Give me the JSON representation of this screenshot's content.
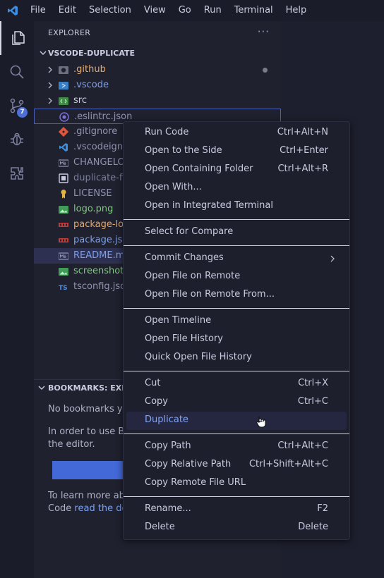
{
  "menubar": {
    "items": [
      "File",
      "Edit",
      "Selection",
      "View",
      "Go",
      "Run",
      "Terminal",
      "Help"
    ]
  },
  "activity_bar": {
    "scm_badge": "7"
  },
  "sidebar": {
    "title": "EXPLORER",
    "more_icon": "···"
  },
  "explorer": {
    "project": "VSCODE-DUPLICATE",
    "items": [
      {
        "name": ".github",
        "icon": "github-folder-icon"
      },
      {
        "name": ".vscode",
        "icon": "vscode-folder-icon"
      },
      {
        "name": "src",
        "icon": "src-folder-icon"
      },
      {
        "name": ".eslintrc.json",
        "icon": "eslint-icon"
      },
      {
        "name": ".gitignore",
        "icon": "git-icon"
      },
      {
        "name": ".vscodeigno",
        "icon": "vscode-icon"
      },
      {
        "name": "CHANGELOG",
        "icon": "markdown-icon"
      },
      {
        "name": "duplicate-fil",
        "icon": "file-icon"
      },
      {
        "name": "LICENSE",
        "icon": "license-icon"
      },
      {
        "name": "logo.png",
        "icon": "image-icon"
      },
      {
        "name": "package-loc",
        "icon": "npm-icon"
      },
      {
        "name": "package.json",
        "icon": "npm-icon"
      },
      {
        "name": "README.md",
        "icon": "markdown-icon"
      },
      {
        "name": "screenshot.p",
        "icon": "image-icon"
      },
      {
        "name": "tsconfig.json",
        "icon": "typescript-icon"
      }
    ]
  },
  "bookmarks": {
    "title": "BOOKMARKS: EXPLO",
    "no_bookmarks": "No bookmarks yet",
    "in_order_line1": "In order to use Bo",
    "in_order_line2": "the editor.",
    "learn_more_line1": "To learn more abo",
    "learn_more_prefix": "Code ",
    "learn_more_link": "read the doc"
  },
  "context_menu": {
    "groups": [
      [
        {
          "label": "Run Code",
          "shortcut": "Ctrl+Alt+N"
        },
        {
          "label": "Open to the Side",
          "shortcut": "Ctrl+Enter"
        },
        {
          "label": "Open Containing Folder",
          "shortcut": "Ctrl+Alt+R"
        },
        {
          "label": "Open With...",
          "shortcut": ""
        },
        {
          "label": "Open in Integrated Terminal",
          "shortcut": ""
        }
      ],
      [
        {
          "label": "Select for Compare",
          "shortcut": ""
        }
      ],
      [
        {
          "label": "Commit Changes",
          "shortcut": "",
          "submenu": true
        },
        {
          "label": "Open File on Remote",
          "shortcut": ""
        },
        {
          "label": "Open File on Remote From...",
          "shortcut": ""
        }
      ],
      [
        {
          "label": "Open Timeline",
          "shortcut": ""
        },
        {
          "label": "Open File History",
          "shortcut": ""
        },
        {
          "label": "Quick Open File History",
          "shortcut": ""
        }
      ],
      [
        {
          "label": "Cut",
          "shortcut": "Ctrl+X"
        },
        {
          "label": "Copy",
          "shortcut": "Ctrl+C"
        },
        {
          "label": "Duplicate",
          "shortcut": "",
          "highlighted": true
        }
      ],
      [
        {
          "label": "Copy Path",
          "shortcut": "Ctrl+Alt+C"
        },
        {
          "label": "Copy Relative Path",
          "shortcut": "Ctrl+Shift+Alt+C"
        },
        {
          "label": "Copy Remote File URL",
          "shortcut": ""
        }
      ],
      [
        {
          "label": "Rename...",
          "shortcut": "F2"
        },
        {
          "label": "Delete",
          "shortcut": "Delete"
        }
      ]
    ]
  },
  "colors": {
    "accent": "#4369d9",
    "selection_border": "#4c62b8",
    "highlight_text": "#7fa3f7"
  }
}
